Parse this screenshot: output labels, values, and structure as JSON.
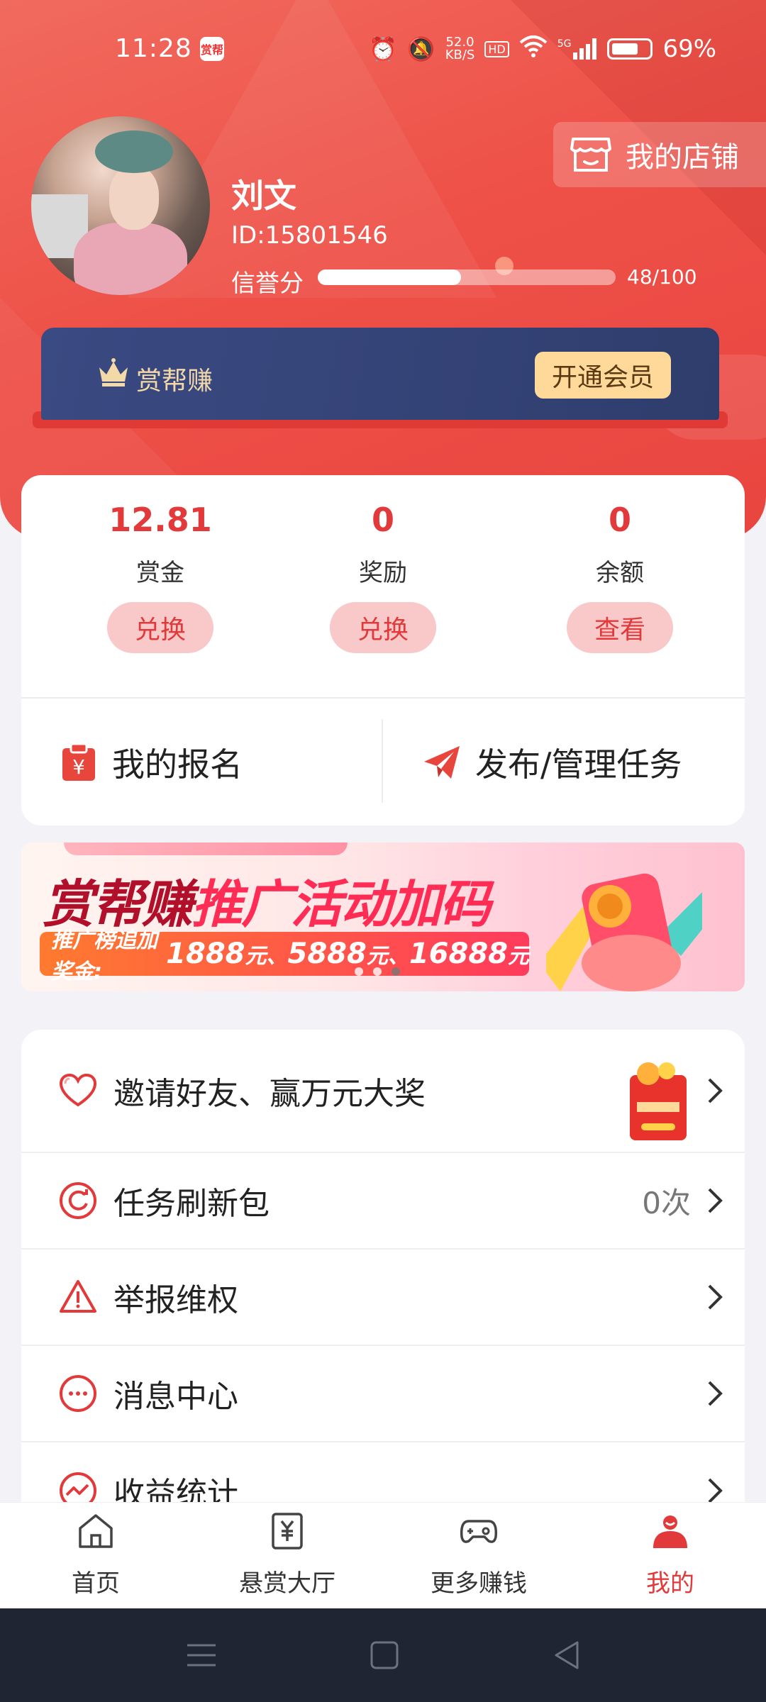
{
  "status_bar": {
    "time": "11:28",
    "app_badge": "赏帮",
    "net_speed_value": "52.0",
    "net_speed_unit": "KB/S",
    "hd": "HD",
    "signal": "5G",
    "battery": "69%"
  },
  "header": {
    "shop_button": "我的店铺",
    "user_name": "刘文",
    "user_id": "ID:15801546",
    "credit_label": "信誉分",
    "credit_value": "48/100",
    "credit_fraction": 0.48
  },
  "vip": {
    "label": "赏帮赚",
    "open_button": "开通会员"
  },
  "stats": [
    {
      "value": "12.81",
      "label": "赏金",
      "button": "兑换"
    },
    {
      "value": "0",
      "label": "奖励",
      "button": "兑换"
    },
    {
      "value": "0",
      "label": "余额",
      "button": "查看"
    }
  ],
  "actions": {
    "my_signup": "我的报名",
    "publish_manage": "发布/管理任务"
  },
  "banner": {
    "title_part1": "赏帮赚",
    "title_part2": "推广活动加码",
    "sub_prefix": "推广榜追加奖金:",
    "amount1": "1888",
    "unit1": "元、",
    "amount2": "5888",
    "unit2": "元、",
    "amount3": "16888",
    "unit3": "元"
  },
  "menu": [
    {
      "label": "邀请好友、赢万元大奖",
      "value": ""
    },
    {
      "label": "任务刷新包",
      "value": "0次"
    },
    {
      "label": "举报维权",
      "value": ""
    },
    {
      "label": "消息中心",
      "value": ""
    },
    {
      "label": "收益统计",
      "value": ""
    }
  ],
  "tabbar": [
    {
      "label": "首页"
    },
    {
      "label": "悬赏大厅"
    },
    {
      "label": "更多赚钱"
    },
    {
      "label": "我的"
    }
  ],
  "colors": {
    "accent_red": "#e23a3a",
    "vip_navy": "#354478",
    "vip_gold": "#ffd99a"
  }
}
